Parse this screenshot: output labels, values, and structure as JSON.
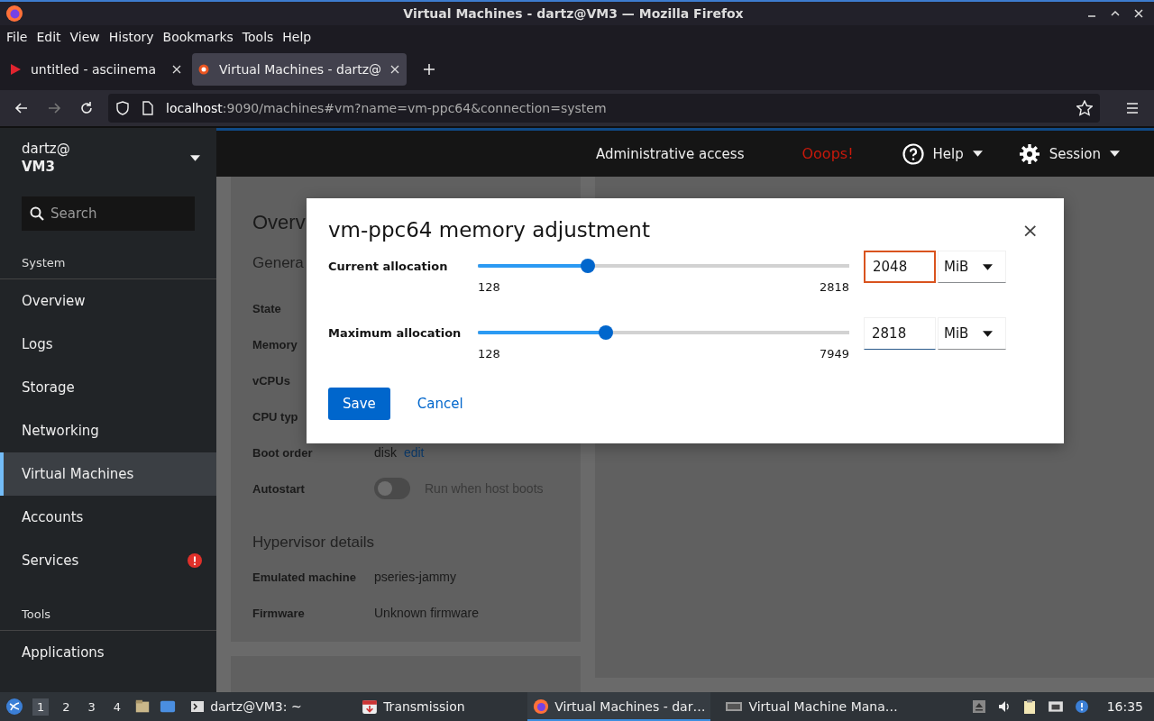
{
  "window": {
    "title": "Virtual Machines - dartz@VM3 — Mozilla Firefox"
  },
  "menu": [
    {
      "label": "File"
    },
    {
      "label": "Edit"
    },
    {
      "label": "View"
    },
    {
      "label": "History"
    },
    {
      "label": "Bookmarks"
    },
    {
      "label": "Tools"
    },
    {
      "label": "Help"
    }
  ],
  "tabs": [
    {
      "label": "untitled - asciinema",
      "selected": false,
      "kind": "play"
    },
    {
      "label": "Virtual Machines - dartz@",
      "selected": true,
      "kind": "cockpit"
    }
  ],
  "url": {
    "host": "localhost",
    "rest": ":9090/machines#vm?name=vm-ppc64&connection=system"
  },
  "host": {
    "user": "dartz@",
    "name": "VM3"
  },
  "search": {
    "placeholder": "Search"
  },
  "sidebar": {
    "sections": [
      {
        "title": "System",
        "items": [
          {
            "label": "Overview",
            "selected": false,
            "alert": false
          },
          {
            "label": "Logs",
            "selected": false,
            "alert": false
          },
          {
            "label": "Storage",
            "selected": false,
            "alert": false
          },
          {
            "label": "Networking",
            "selected": false,
            "alert": false
          },
          {
            "label": "Virtual Machines",
            "selected": true,
            "alert": false
          },
          {
            "label": "Accounts",
            "selected": false,
            "alert": false
          },
          {
            "label": "Services",
            "selected": false,
            "alert": true
          }
        ]
      },
      {
        "title": "Tools",
        "items": [
          {
            "label": "Applications",
            "selected": false,
            "alert": false
          }
        ]
      }
    ]
  },
  "topbar": {
    "access": "Administrative access",
    "error": "Ooops!",
    "help": "Help",
    "session": "Session"
  },
  "page": {
    "heading": "Overv",
    "general": "Genera",
    "fields": [
      {
        "label": "State"
      },
      {
        "label": "Memory"
      },
      {
        "label": "vCPUs"
      },
      {
        "label": "CPU typ"
      },
      {
        "label": "Boot order",
        "value": "disk",
        "link": "edit"
      },
      {
        "label": "Autostart",
        "toggle": {
          "on": false,
          "label": "Run when host boots"
        }
      }
    ],
    "hypervisor": {
      "title": "Hypervisor details",
      "fields": [
        {
          "label": "Emulated machine",
          "value": "pseries-jammy"
        },
        {
          "label": "Firmware",
          "value": "Unknown firmware"
        }
      ]
    }
  },
  "dialog": {
    "title": "vm-ppc64 memory adjustment",
    "close": "×",
    "rows": [
      {
        "label": "Current allocation",
        "level": 0.296,
        "min": "128",
        "max": "2818",
        "value": "2048",
        "unit": "MiB",
        "focused": true
      },
      {
        "label": "Maximum allocation",
        "level": 0.345,
        "min": "128",
        "max": "7949",
        "value": "2818",
        "unit": "MiB",
        "focused": false
      }
    ],
    "save": "Save",
    "cancel": "Cancel"
  },
  "taskbar": {
    "workspaces": [
      {
        "label": "1",
        "selected": true
      },
      {
        "label": "2",
        "selected": false
      },
      {
        "label": "3",
        "selected": false
      },
      {
        "label": "4",
        "selected": false
      }
    ],
    "tasks": [
      {
        "label": "dartz@VM3: ~",
        "kind": "terminal",
        "selected": false
      },
      {
        "label": "Transmission",
        "kind": "transmission",
        "selected": false
      },
      {
        "label": "Virtual Machines - dar…",
        "kind": "firefox",
        "selected": true
      },
      {
        "label": "Virtual Machine Mana…",
        "kind": "vmm",
        "selected": false
      }
    ],
    "clock": "16:35"
  }
}
